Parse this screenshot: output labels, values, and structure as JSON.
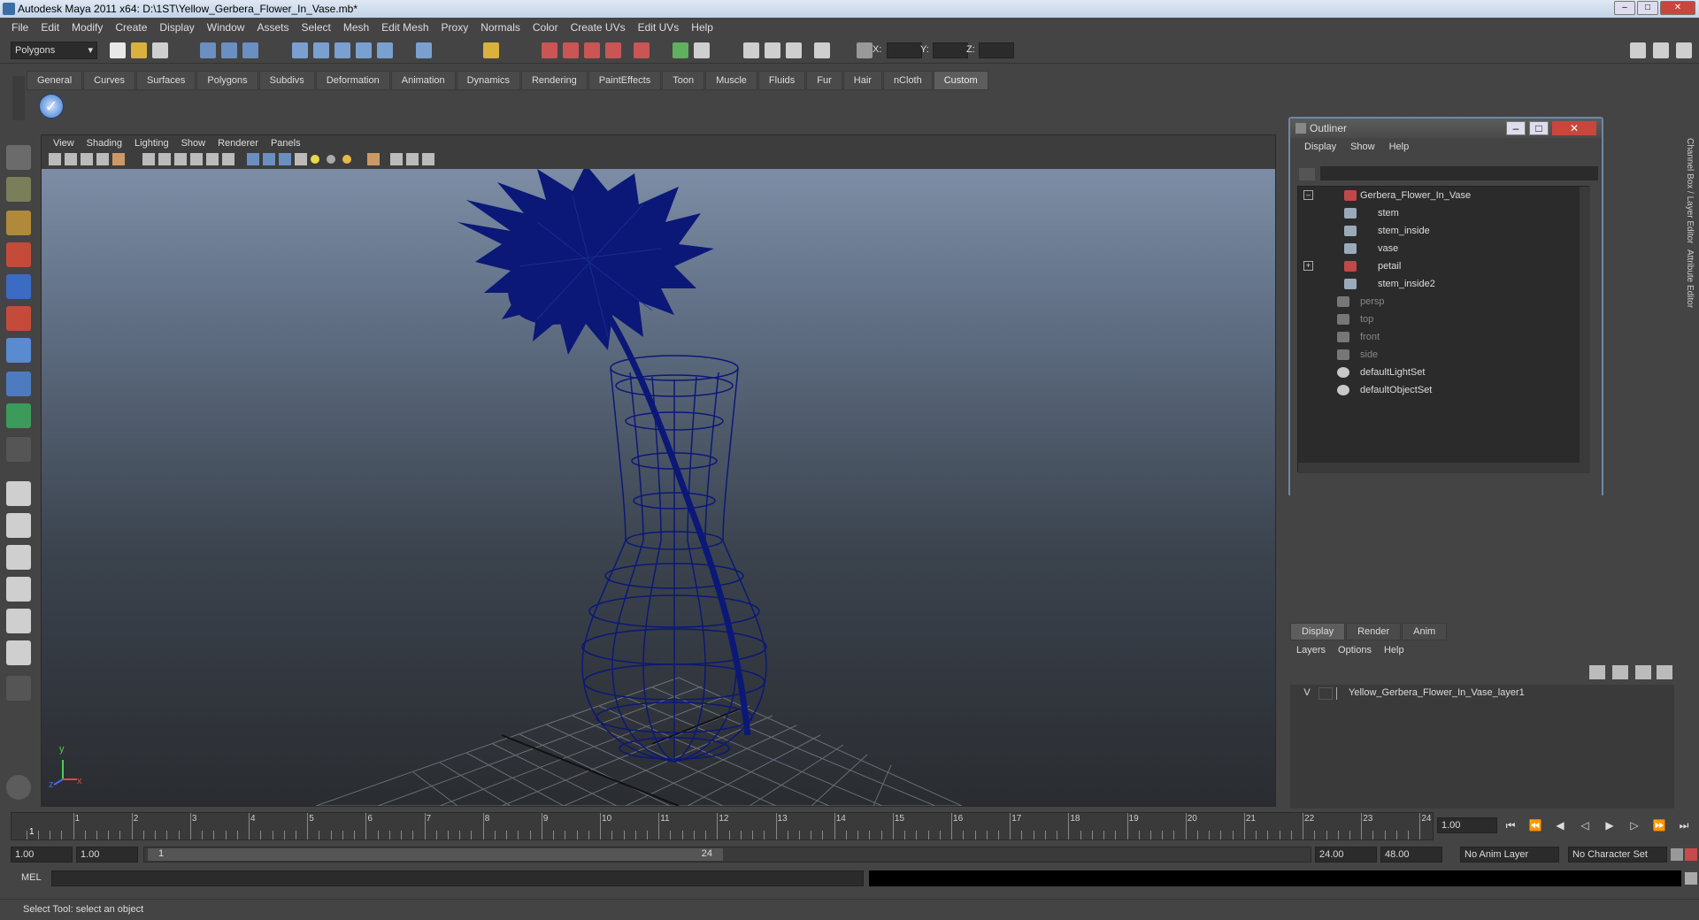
{
  "window": {
    "title": "Autodesk Maya 2011 x64: D:\\1ST\\Yellow_Gerbera_Flower_In_Vase.mb*"
  },
  "menubar": [
    "File",
    "Edit",
    "Modify",
    "Create",
    "Display",
    "Window",
    "Assets",
    "Select",
    "Mesh",
    "Edit Mesh",
    "Proxy",
    "Normals",
    "Color",
    "Create UVs",
    "Edit UVs",
    "Help"
  ],
  "status": {
    "menu_set": "Polygons",
    "x_label": "X:",
    "y_label": "Y:",
    "z_label": "Z:"
  },
  "shelf": {
    "tabs": [
      "General",
      "Curves",
      "Surfaces",
      "Polygons",
      "Subdivs",
      "Deformation",
      "Animation",
      "Dynamics",
      "Rendering",
      "PaintEffects",
      "Toon",
      "Muscle",
      "Fluids",
      "Fur",
      "Hair",
      "nCloth",
      "Custom"
    ],
    "active": "Custom"
  },
  "viewport": {
    "menu": [
      "View",
      "Shading",
      "Lighting",
      "Show",
      "Renderer",
      "Panels"
    ],
    "axis_y": "y",
    "axis_x": "x",
    "axis_z": "z"
  },
  "outliner": {
    "title": "Outliner",
    "menu": [
      "Display",
      "Show",
      "Help"
    ],
    "items": [
      {
        "label": "Gerbera_Flower_In_Vase",
        "dim": false
      },
      {
        "label": "stem",
        "dim": false
      },
      {
        "label": "stem_inside",
        "dim": false
      },
      {
        "label": "vase",
        "dim": false
      },
      {
        "label": "petail",
        "dim": false
      },
      {
        "label": "stem_inside2",
        "dim": false
      },
      {
        "label": "persp",
        "dim": true
      },
      {
        "label": "top",
        "dim": true
      },
      {
        "label": "front",
        "dim": true
      },
      {
        "label": "side",
        "dim": true
      },
      {
        "label": "defaultLightSet",
        "dim": false
      },
      {
        "label": "defaultObjectSet",
        "dim": false
      }
    ]
  },
  "side_strip": {
    "channel_box": "Channel Box / Layer Editor",
    "attribute_editor": "Attribute Editor"
  },
  "layer_editor": {
    "tabs": [
      "Display",
      "Render",
      "Anim"
    ],
    "active": "Display",
    "menu": [
      "Layers",
      "Options",
      "Help"
    ],
    "visibility": "V",
    "layer_name": "Yellow_Gerbera_Flower_In_Vase_layer1"
  },
  "timeline": {
    "ticks": [
      "1",
      "2",
      "3",
      "4",
      "5",
      "6",
      "7",
      "8",
      "9",
      "10",
      "11",
      "12",
      "13",
      "14",
      "15",
      "16",
      "17",
      "18",
      "19",
      "20",
      "21",
      "22",
      "23",
      "24"
    ],
    "current_frame": "1.00",
    "current_marker": "1"
  },
  "range": {
    "start_time": "1.00",
    "playback_start": "1.00",
    "slider_start": "1",
    "slider_end": "24",
    "playback_end": "24.00",
    "end_time": "48.00",
    "anim_layer": "No Anim Layer",
    "character_set": "No Character Set"
  },
  "cmdline": {
    "label": "MEL"
  },
  "helpline": {
    "text": "Select Tool: select an object"
  },
  "colors": {
    "wire": "#0b1877",
    "accent": "#6f87a8",
    "bg": "#444444"
  }
}
